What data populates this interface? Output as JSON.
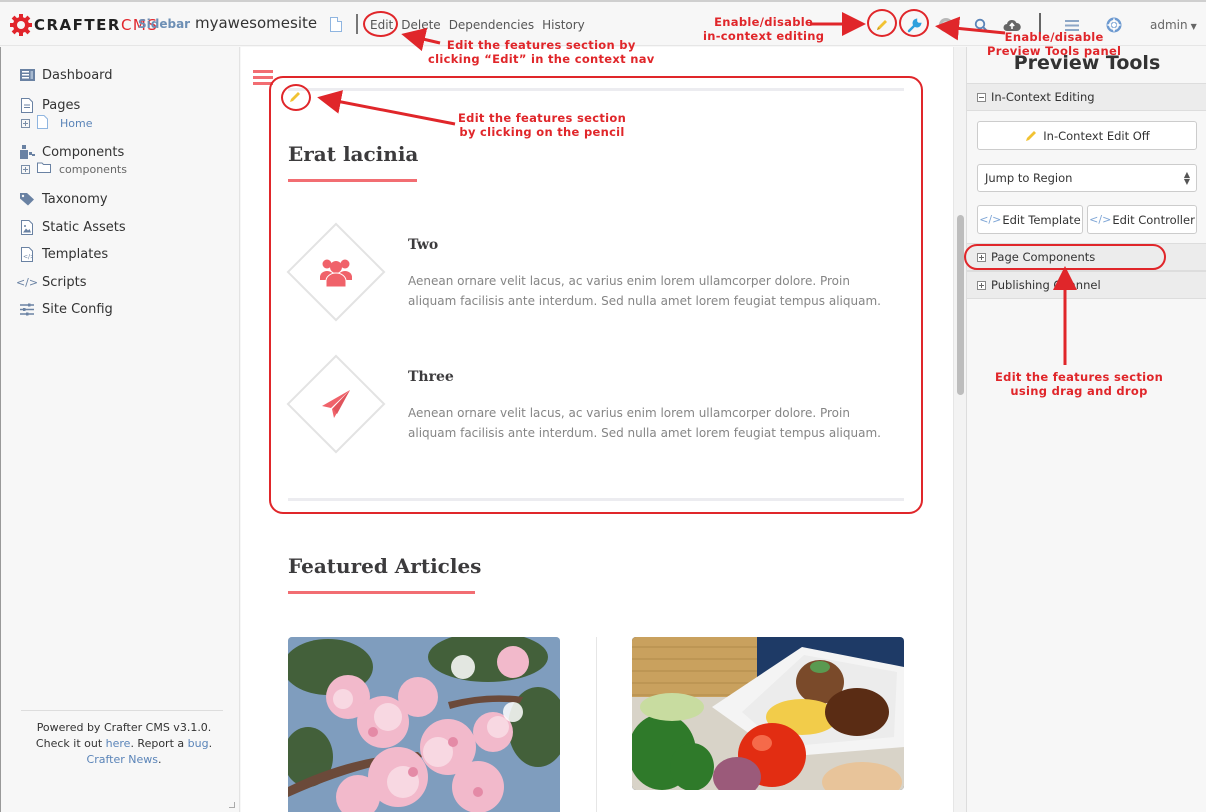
{
  "topbar": {
    "logo_dark": "CRAFTER",
    "logo_red": "CMS",
    "sidebar_toggle": "Sidebar",
    "site_name": "myawesomesite",
    "context_nav": [
      "Edit",
      "Delete",
      "Dependencies",
      "History"
    ],
    "icons": [
      "pencil-icon",
      "wrench-icon",
      "radar-icon",
      "search-icon",
      "cloud-upload-icon",
      "menu-icon",
      "help-lifesaver-icon"
    ],
    "user": "admin"
  },
  "sidebar": {
    "items": [
      {
        "label": "Dashboard",
        "icon": "dashboard-icon"
      },
      {
        "label": "Pages",
        "icon": "page-icon",
        "child": "Home"
      },
      {
        "label": "Components",
        "icon": "components-icon",
        "child": "components"
      },
      {
        "label": "Taxonomy",
        "icon": "tag-icon"
      },
      {
        "label": "Static Assets",
        "icon": "image-file-icon"
      },
      {
        "label": "Templates",
        "icon": "template-file-icon"
      },
      {
        "label": "Scripts",
        "icon": "code-icon"
      },
      {
        "label": "Site Config",
        "icon": "sliders-icon"
      }
    ],
    "footer": {
      "prefix": "Powered by Crafter CMS v3.1.0. Check it out ",
      "link_here": "here",
      "mid": ". Report a ",
      "link_bug": "bug",
      "sep": ". ",
      "link_news": "Crafter News",
      "suffix": "."
    }
  },
  "main": {
    "features_title": "Erat lacinia",
    "features": [
      {
        "title": "Two",
        "icon": "users-icon",
        "text": "Aenean ornare velit lacus, ac varius enim lorem ullamcorper dolore. Proin aliquam facilisis ante interdum. Sed nulla amet lorem feugiat tempus aliquam."
      },
      {
        "title": "Three",
        "icon": "paper-plane-icon",
        "text": "Aenean ornare velit lacus, ac varius enim lorem ullamcorper dolore. Proin aliquam facilisis ante interdum. Sed nulla amet lorem feugiat tempus aliquam."
      }
    ],
    "articles_title": "Featured Articles",
    "articles": [
      {
        "image": "pink-blossoms-photo"
      },
      {
        "image": "food-plate-photo"
      }
    ]
  },
  "preview_tools": {
    "title": "Preview Tools",
    "in_context_header": "In-Context Editing",
    "ice_button": "In-Context Edit Off",
    "jump_to_region": "Jump to Region",
    "edit_template": "Edit Template",
    "edit_controller": "Edit Controller",
    "page_components": "Page Components",
    "publishing_channel": "Publishing Channel"
  },
  "annotations": {
    "context_nav": "Edit the features section by\nclicking “Edit” in the context nav",
    "ice_toggle": "Enable/disable\nin-context editing",
    "preview_tools": "Enable/disable\nPreview Tools panel",
    "pencil": "Edit the features section\nby clicking on the pencil",
    "drag_drop": "Edit the features section\nusing drag and drop"
  },
  "colors": {
    "brand_red": "#e1252c",
    "accent_coral": "#f26d72",
    "annotation_red": "#e0262a",
    "link_blue": "#5a84b8"
  }
}
